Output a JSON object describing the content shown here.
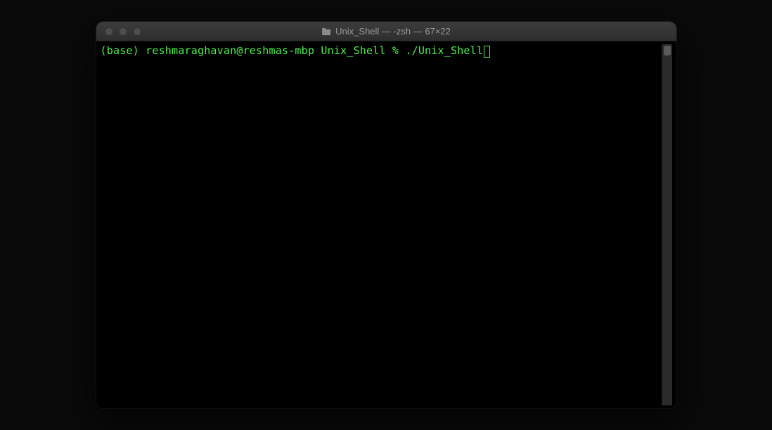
{
  "window": {
    "title": "Unix_Shell — -zsh — 67×22"
  },
  "terminal": {
    "prompt": "(base) reshmaraghavan@reshmas-mbp Unix_Shell % ",
    "command": "./Unix_Shell"
  },
  "colors": {
    "text": "#4af04a",
    "background": "#000000"
  }
}
